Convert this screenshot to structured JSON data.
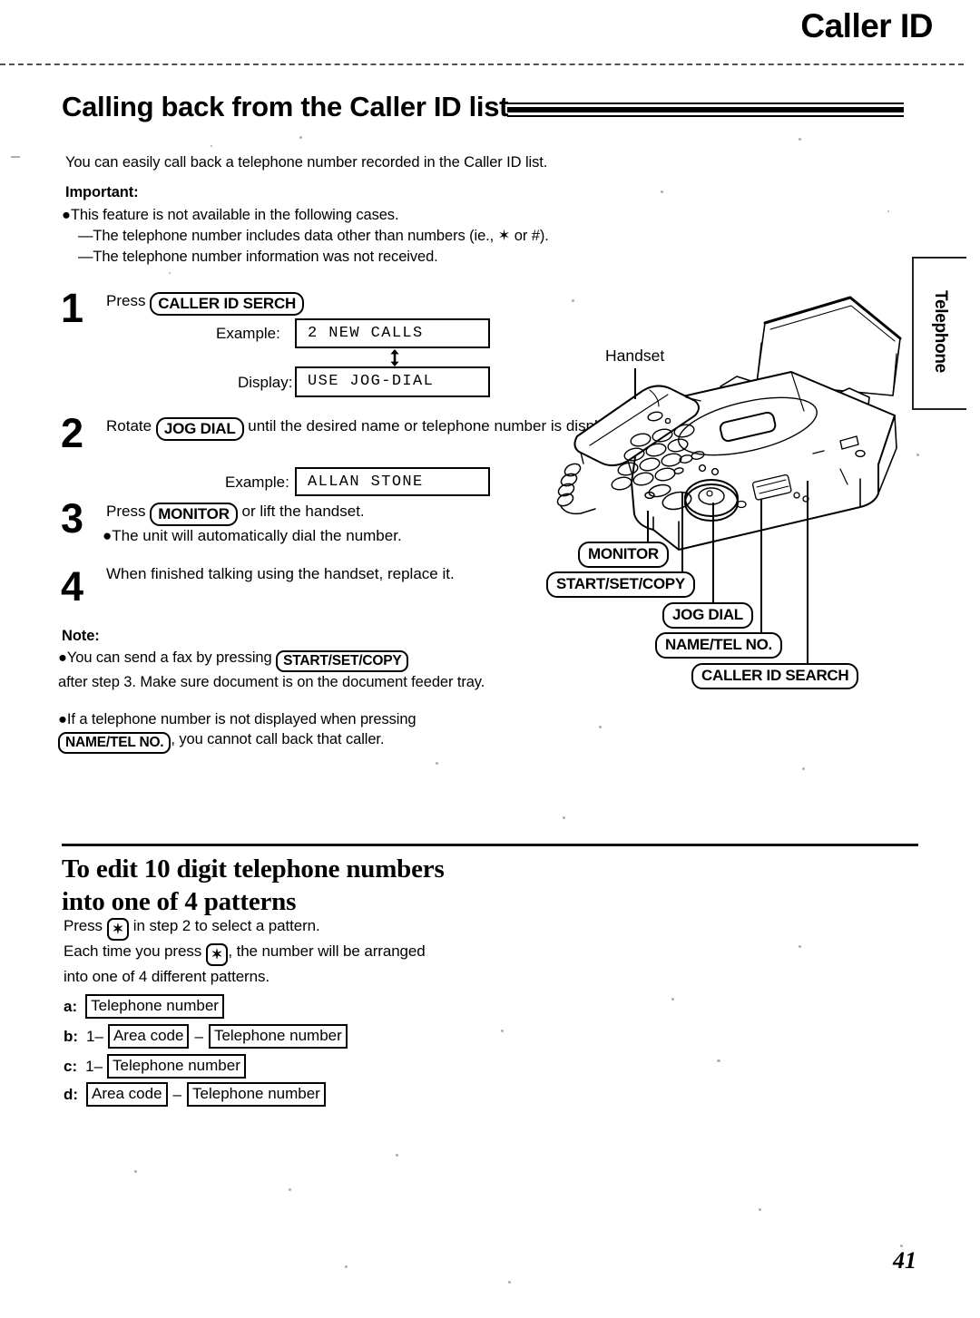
{
  "document": {
    "running_head": "Caller ID",
    "page_number": "41",
    "side_tab_label": "Telephone"
  },
  "section": {
    "title": "Calling back from the Caller ID list",
    "intro": "You can easily call back a telephone number recorded in the Caller ID list.",
    "important_label": "Important:",
    "important_bullet": "This feature is not available in the following cases.",
    "important_dash_1": "The telephone number includes data other than numbers (ie., ✶ or #).",
    "important_dash_2": "The telephone number information was not received."
  },
  "steps": [
    {
      "number": "1",
      "text_before": "Press",
      "key": "CALLER ID SERCH",
      "text_after": "",
      "example_label": "Example:",
      "example_value": "2 NEW CALLS",
      "display_label": "Display:",
      "display_value": "USE JOG-DIAL"
    },
    {
      "number": "2",
      "text_before": "Rotate",
      "key": "JOG DIAL",
      "text_after": "until the desired name or telephone number is displayed.",
      "example_label": "Example:",
      "example_value": "ALLAN STONE"
    },
    {
      "number": "3",
      "text_before": "Press",
      "key": "MONITOR",
      "text_after": "or lift the handset.",
      "bullet": "The unit will automatically dial the number."
    },
    {
      "number": "4",
      "text": "When finished talking using the handset, replace it."
    }
  ],
  "note": {
    "label": "Note:",
    "bullet_1_before": "You can send a fax by pressing",
    "bullet_1_key": "START/SET/COPY",
    "bullet_1_after": "after step 3. Make sure document is on the document feeder tray.",
    "bullet_2_before": "If a telephone number is not displayed when pressing",
    "bullet_2_key": "NAME/TEL NO.",
    "bullet_2_after": ", you cannot call back that caller."
  },
  "illustration": {
    "handset_label": "Handset",
    "callouts": [
      {
        "label": "MONITOR"
      },
      {
        "label": "START/SET/COPY"
      },
      {
        "label": "JOG DIAL"
      },
      {
        "label": "NAME/TEL NO."
      },
      {
        "label": "CALLER ID SEARCH"
      }
    ]
  },
  "edit_section": {
    "heading_line_1": "To edit 10 digit telephone numbers",
    "heading_line_2": "into one of 4 patterns",
    "intro_line_1_before": "Press",
    "intro_star": "✶",
    "intro_line_1_after": "in step 2 to select a pattern.",
    "intro_line_2_before": "Each time you press",
    "intro_line_2_after": ", the number will be arranged",
    "intro_line_3": "into one of 4 different patterns.",
    "patterns": [
      {
        "letter": "a:",
        "lead": "",
        "fields": [
          "Telephone number"
        ],
        "separators": []
      },
      {
        "letter": "b:",
        "lead": "1–",
        "fields": [
          "Area code",
          "Telephone number"
        ],
        "separators": [
          "–"
        ]
      },
      {
        "letter": "c:",
        "lead": "1–",
        "fields": [
          "Telephone number"
        ],
        "separators": []
      },
      {
        "letter": "d:",
        "lead": "",
        "fields": [
          "Area code",
          "Telephone number"
        ],
        "separators": [
          "–"
        ]
      }
    ]
  }
}
